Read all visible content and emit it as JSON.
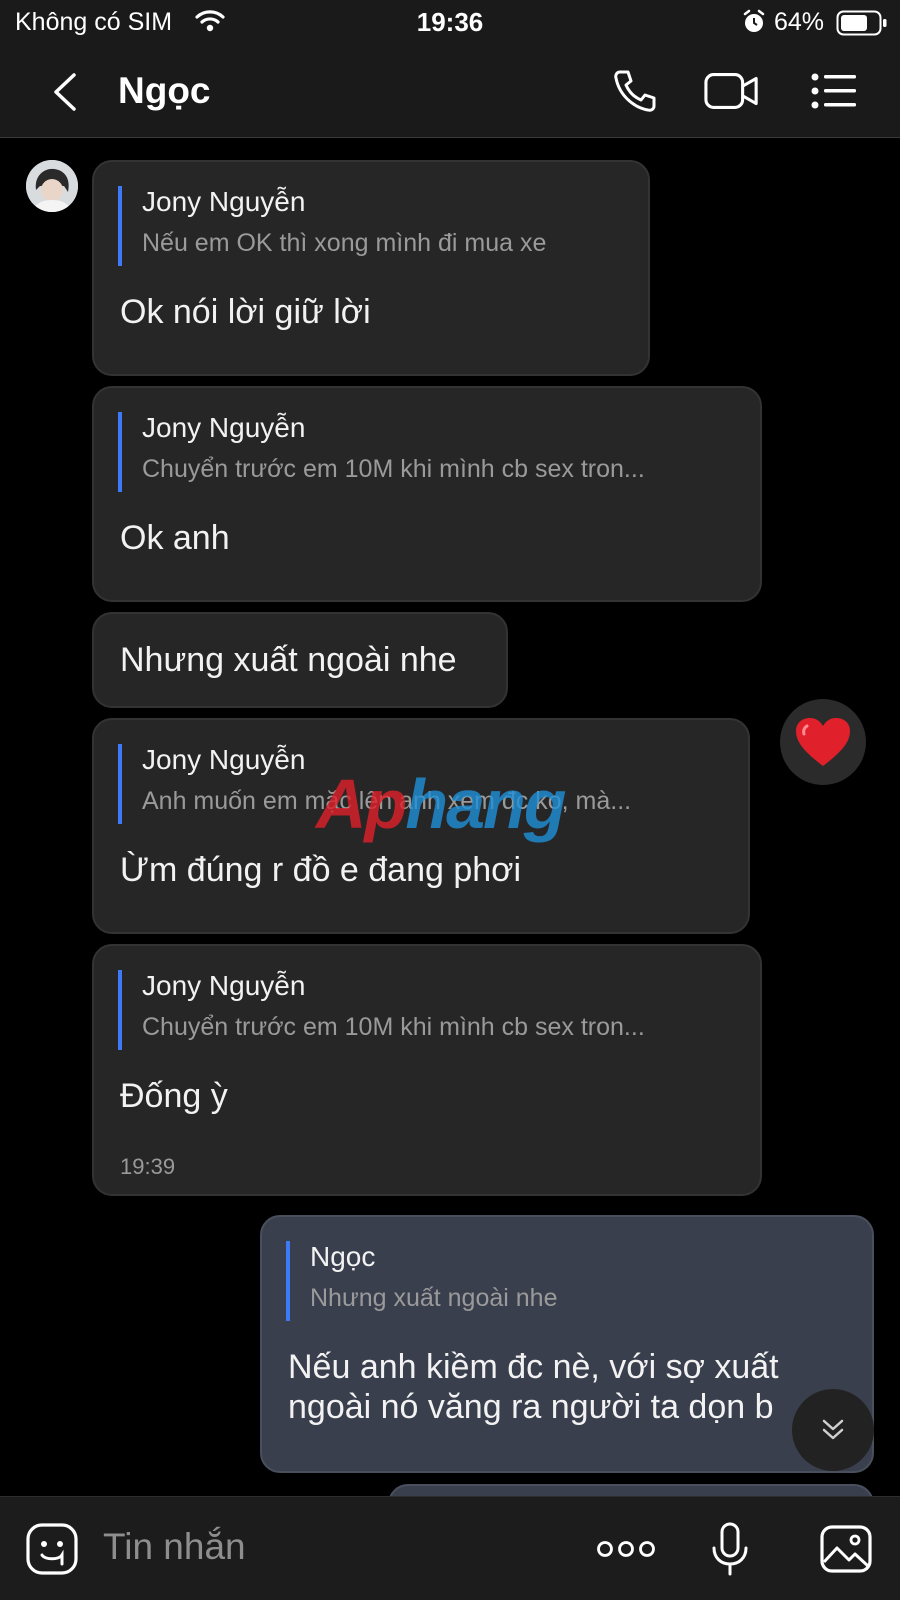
{
  "status_bar": {
    "carrier": "Không có SIM",
    "time": "19:36",
    "battery": "64%"
  },
  "header": {
    "title": "Ngọc"
  },
  "messages": [
    {
      "reply_name": "Jony Nguyễn",
      "reply_text": "Nếu em OK thì xong mình đi mua xe",
      "text": "Ok nói lời giữ lời"
    },
    {
      "reply_name": "Jony Nguyễn",
      "reply_text": "Chuyển trước em 10M khi mình cb sex tron...",
      "text": "Ok anh"
    },
    {
      "text": "Nhưng xuất ngoài nhe"
    },
    {
      "reply_name": "Jony Nguyễn",
      "reply_text": "Anh muốn em mặc lên anh xem đc ko, mà...",
      "text": "Ừm đúng r đồ e đang phơi"
    },
    {
      "reply_name": "Jony Nguyễn",
      "reply_text": "Chuyển trước em 10M khi mình cb sex tron...",
      "text": "Đống ỳ",
      "time": "19:39"
    },
    {
      "reply_name": "Ngọc",
      "reply_text": "Nhưng xuất ngoài nhe",
      "text_line1": "Nếu anh kiềm đc nè, với sợ xuất",
      "text_line2": "ngoài nó văng ra người ta dọn b"
    }
  ],
  "watermark": {
    "part1": "Ap",
    "part2": "hang"
  },
  "input": {
    "placeholder": "Tin nhắn"
  },
  "colors": {
    "incoming_bubble": "#262626",
    "outgoing_bubble": "#3a3f4d",
    "reply_bar": "#3d7bf6",
    "reaction": "#e0202a"
  },
  "icons": [
    "wifi-icon",
    "alarm-icon",
    "battery-icon",
    "back-icon",
    "phone-icon",
    "video-icon",
    "list-menu-icon",
    "heart-icon",
    "chevron-double-down-icon",
    "sticker-icon",
    "more-icon",
    "microphone-icon",
    "image-icon"
  ]
}
